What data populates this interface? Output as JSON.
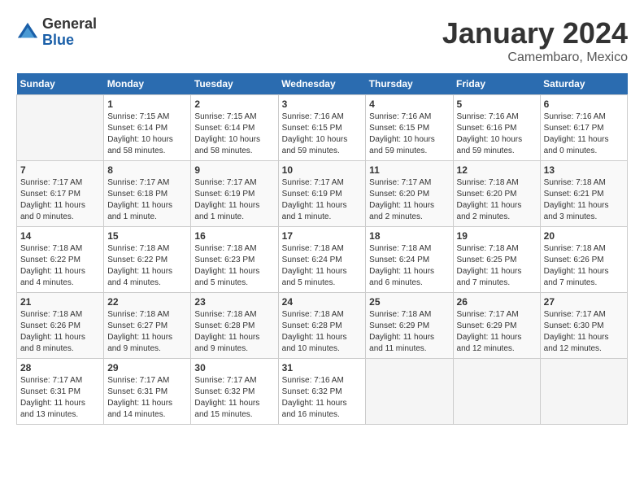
{
  "logo": {
    "general": "General",
    "blue": "Blue"
  },
  "title": "January 2024",
  "location": "Camembaro, Mexico",
  "days_of_week": [
    "Sunday",
    "Monday",
    "Tuesday",
    "Wednesday",
    "Thursday",
    "Friday",
    "Saturday"
  ],
  "weeks": [
    [
      {
        "day": "",
        "sunrise": "",
        "sunset": "",
        "daylight": ""
      },
      {
        "day": "1",
        "sunrise": "Sunrise: 7:15 AM",
        "sunset": "Sunset: 6:14 PM",
        "daylight": "Daylight: 10 hours and 58 minutes."
      },
      {
        "day": "2",
        "sunrise": "Sunrise: 7:15 AM",
        "sunset": "Sunset: 6:14 PM",
        "daylight": "Daylight: 10 hours and 58 minutes."
      },
      {
        "day": "3",
        "sunrise": "Sunrise: 7:16 AM",
        "sunset": "Sunset: 6:15 PM",
        "daylight": "Daylight: 10 hours and 59 minutes."
      },
      {
        "day": "4",
        "sunrise": "Sunrise: 7:16 AM",
        "sunset": "Sunset: 6:15 PM",
        "daylight": "Daylight: 10 hours and 59 minutes."
      },
      {
        "day": "5",
        "sunrise": "Sunrise: 7:16 AM",
        "sunset": "Sunset: 6:16 PM",
        "daylight": "Daylight: 10 hours and 59 minutes."
      },
      {
        "day": "6",
        "sunrise": "Sunrise: 7:16 AM",
        "sunset": "Sunset: 6:17 PM",
        "daylight": "Daylight: 11 hours and 0 minutes."
      }
    ],
    [
      {
        "day": "7",
        "sunrise": "Sunrise: 7:17 AM",
        "sunset": "Sunset: 6:17 PM",
        "daylight": "Daylight: 11 hours and 0 minutes."
      },
      {
        "day": "8",
        "sunrise": "Sunrise: 7:17 AM",
        "sunset": "Sunset: 6:18 PM",
        "daylight": "Daylight: 11 hours and 1 minute."
      },
      {
        "day": "9",
        "sunrise": "Sunrise: 7:17 AM",
        "sunset": "Sunset: 6:19 PM",
        "daylight": "Daylight: 11 hours and 1 minute."
      },
      {
        "day": "10",
        "sunrise": "Sunrise: 7:17 AM",
        "sunset": "Sunset: 6:19 PM",
        "daylight": "Daylight: 11 hours and 1 minute."
      },
      {
        "day": "11",
        "sunrise": "Sunrise: 7:17 AM",
        "sunset": "Sunset: 6:20 PM",
        "daylight": "Daylight: 11 hours and 2 minutes."
      },
      {
        "day": "12",
        "sunrise": "Sunrise: 7:18 AM",
        "sunset": "Sunset: 6:20 PM",
        "daylight": "Daylight: 11 hours and 2 minutes."
      },
      {
        "day": "13",
        "sunrise": "Sunrise: 7:18 AM",
        "sunset": "Sunset: 6:21 PM",
        "daylight": "Daylight: 11 hours and 3 minutes."
      }
    ],
    [
      {
        "day": "14",
        "sunrise": "Sunrise: 7:18 AM",
        "sunset": "Sunset: 6:22 PM",
        "daylight": "Daylight: 11 hours and 4 minutes."
      },
      {
        "day": "15",
        "sunrise": "Sunrise: 7:18 AM",
        "sunset": "Sunset: 6:22 PM",
        "daylight": "Daylight: 11 hours and 4 minutes."
      },
      {
        "day": "16",
        "sunrise": "Sunrise: 7:18 AM",
        "sunset": "Sunset: 6:23 PM",
        "daylight": "Daylight: 11 hours and 5 minutes."
      },
      {
        "day": "17",
        "sunrise": "Sunrise: 7:18 AM",
        "sunset": "Sunset: 6:24 PM",
        "daylight": "Daylight: 11 hours and 5 minutes."
      },
      {
        "day": "18",
        "sunrise": "Sunrise: 7:18 AM",
        "sunset": "Sunset: 6:24 PM",
        "daylight": "Daylight: 11 hours and 6 minutes."
      },
      {
        "day": "19",
        "sunrise": "Sunrise: 7:18 AM",
        "sunset": "Sunset: 6:25 PM",
        "daylight": "Daylight: 11 hours and 7 minutes."
      },
      {
        "day": "20",
        "sunrise": "Sunrise: 7:18 AM",
        "sunset": "Sunset: 6:26 PM",
        "daylight": "Daylight: 11 hours and 7 minutes."
      }
    ],
    [
      {
        "day": "21",
        "sunrise": "Sunrise: 7:18 AM",
        "sunset": "Sunset: 6:26 PM",
        "daylight": "Daylight: 11 hours and 8 minutes."
      },
      {
        "day": "22",
        "sunrise": "Sunrise: 7:18 AM",
        "sunset": "Sunset: 6:27 PM",
        "daylight": "Daylight: 11 hours and 9 minutes."
      },
      {
        "day": "23",
        "sunrise": "Sunrise: 7:18 AM",
        "sunset": "Sunset: 6:28 PM",
        "daylight": "Daylight: 11 hours and 9 minutes."
      },
      {
        "day": "24",
        "sunrise": "Sunrise: 7:18 AM",
        "sunset": "Sunset: 6:28 PM",
        "daylight": "Daylight: 11 hours and 10 minutes."
      },
      {
        "day": "25",
        "sunrise": "Sunrise: 7:18 AM",
        "sunset": "Sunset: 6:29 PM",
        "daylight": "Daylight: 11 hours and 11 minutes."
      },
      {
        "day": "26",
        "sunrise": "Sunrise: 7:17 AM",
        "sunset": "Sunset: 6:29 PM",
        "daylight": "Daylight: 11 hours and 12 minutes."
      },
      {
        "day": "27",
        "sunrise": "Sunrise: 7:17 AM",
        "sunset": "Sunset: 6:30 PM",
        "daylight": "Daylight: 11 hours and 12 minutes."
      }
    ],
    [
      {
        "day": "28",
        "sunrise": "Sunrise: 7:17 AM",
        "sunset": "Sunset: 6:31 PM",
        "daylight": "Daylight: 11 hours and 13 minutes."
      },
      {
        "day": "29",
        "sunrise": "Sunrise: 7:17 AM",
        "sunset": "Sunset: 6:31 PM",
        "daylight": "Daylight: 11 hours and 14 minutes."
      },
      {
        "day": "30",
        "sunrise": "Sunrise: 7:17 AM",
        "sunset": "Sunset: 6:32 PM",
        "daylight": "Daylight: 11 hours and 15 minutes."
      },
      {
        "day": "31",
        "sunrise": "Sunrise: 7:16 AM",
        "sunset": "Sunset: 6:32 PM",
        "daylight": "Daylight: 11 hours and 16 minutes."
      },
      {
        "day": "",
        "sunrise": "",
        "sunset": "",
        "daylight": ""
      },
      {
        "day": "",
        "sunrise": "",
        "sunset": "",
        "daylight": ""
      },
      {
        "day": "",
        "sunrise": "",
        "sunset": "",
        "daylight": ""
      }
    ]
  ]
}
